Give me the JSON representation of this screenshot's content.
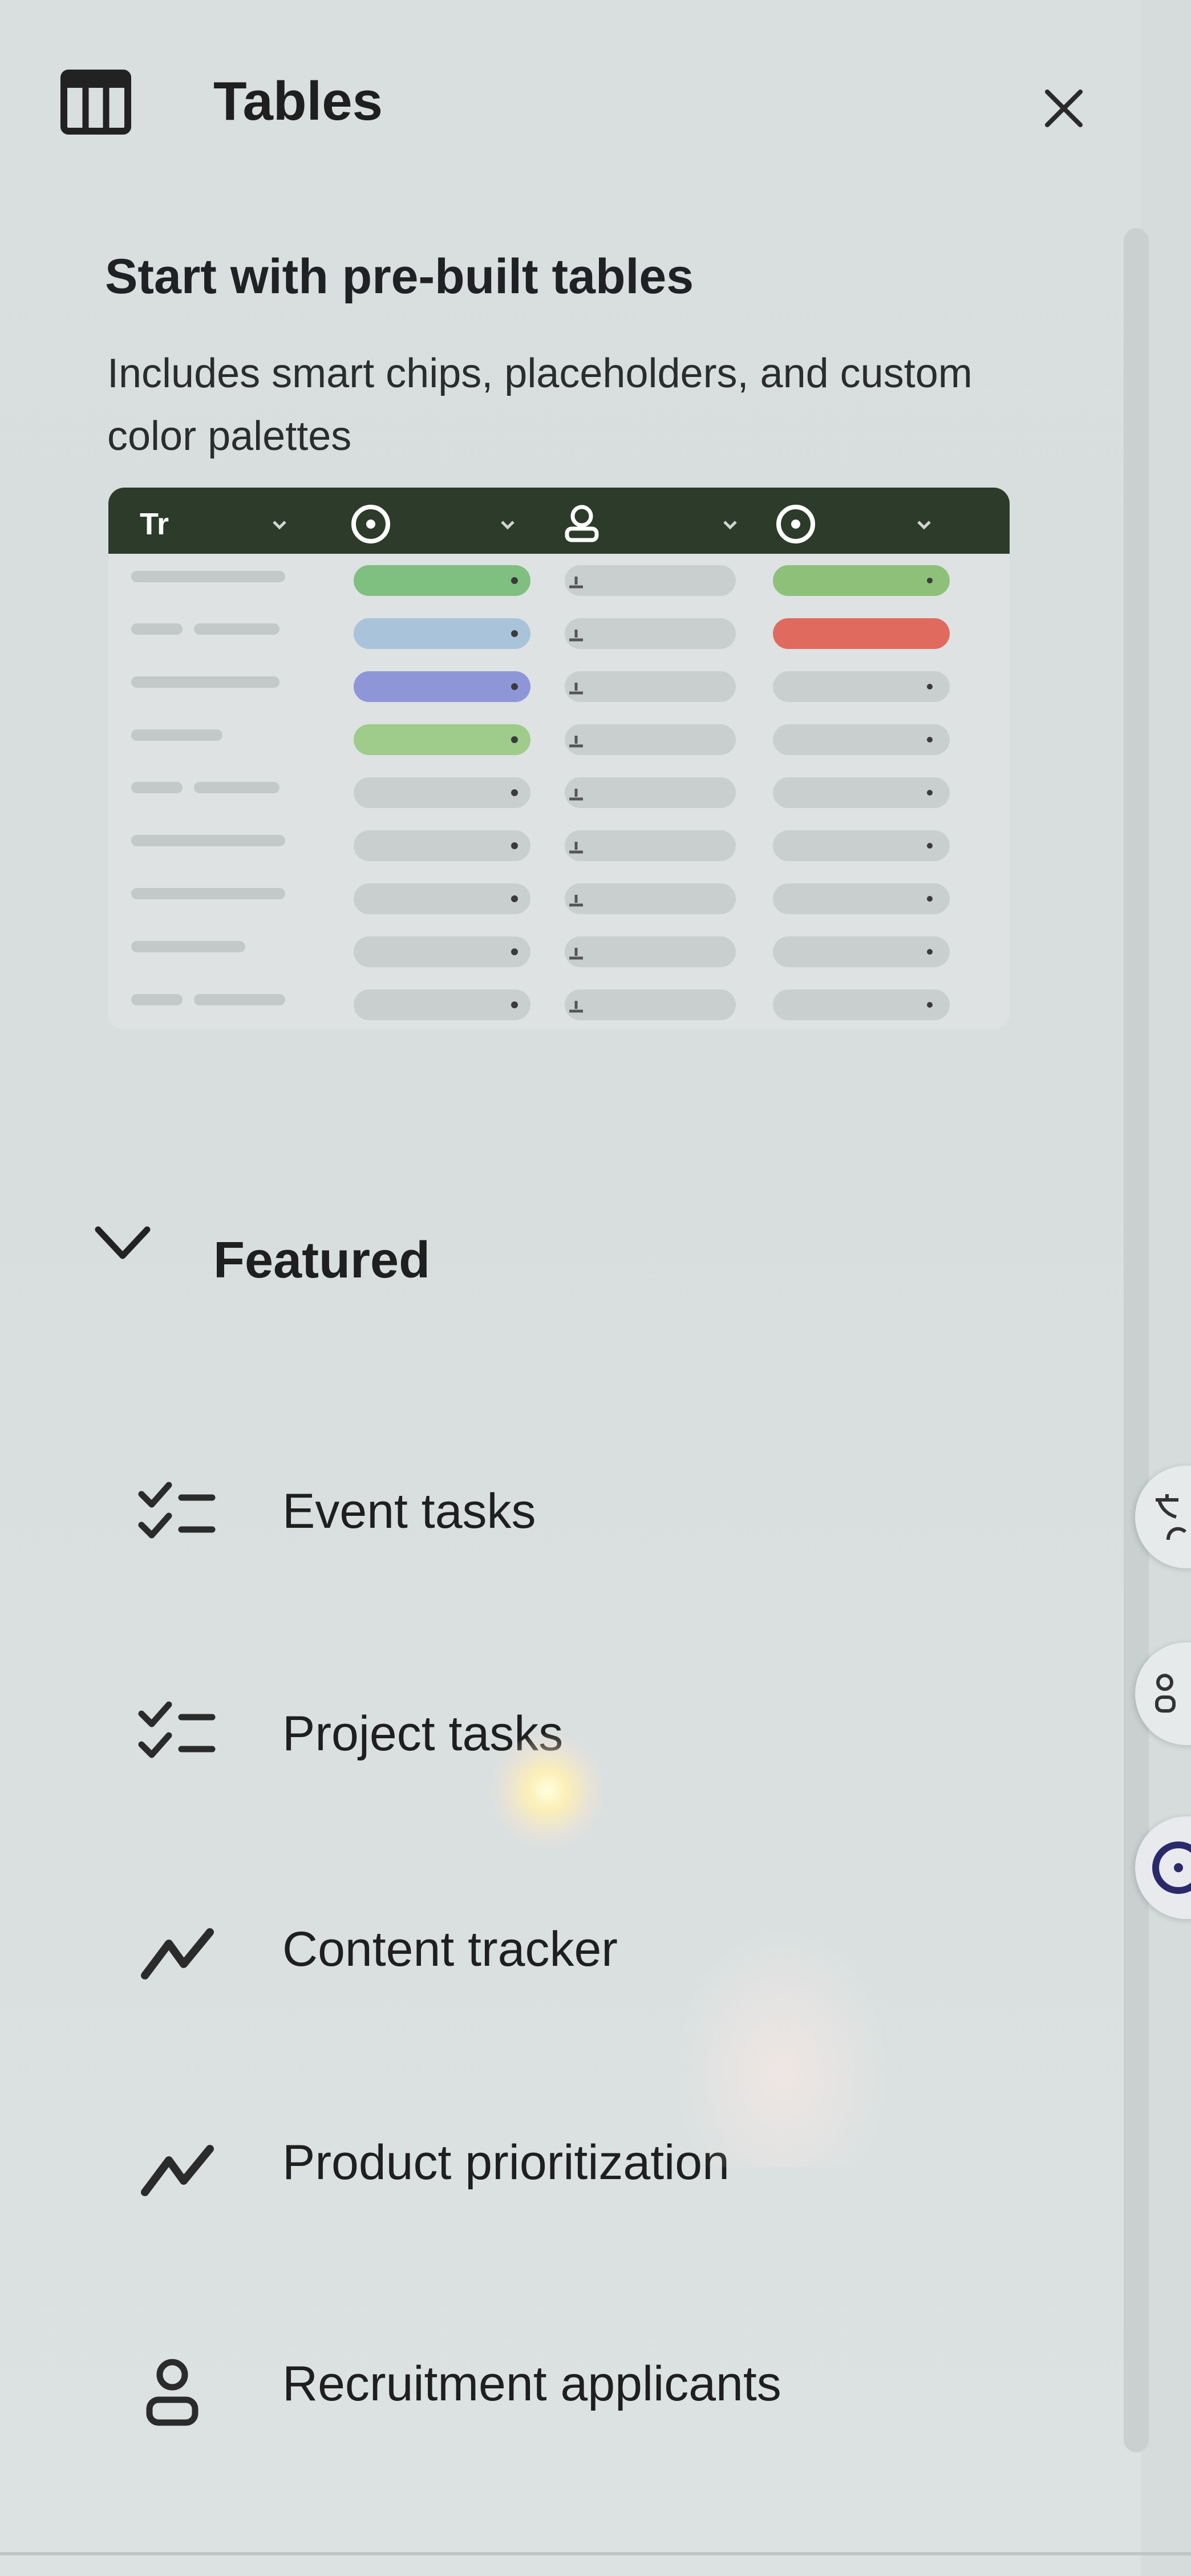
{
  "header": {
    "title": "Tables",
    "icon": "table-icon",
    "close_icon": "close-icon"
  },
  "intro": {
    "heading": "Start with pre-built tables",
    "description": "Includes smart chips, placeholders, and custom color palettes"
  },
  "preview": {
    "header_bg": "#2c3b2a",
    "columns": [
      {
        "icon": "text-type-icon",
        "glyph": "Tr"
      },
      {
        "icon": "dropdown-chip-icon"
      },
      {
        "icon": "person-icon"
      },
      {
        "icon": "dropdown-chip-icon"
      }
    ],
    "chip_colors": {
      "green": "#7fbf7f",
      "blue": "#a9c3db",
      "purple": "#8f96d8",
      "lightgreen": "#9fcb8b",
      "red": "#e06a5e",
      "grey": "#c9cfcf"
    }
  },
  "featured": {
    "label": "Featured",
    "toggle_icon": "chevron-down-icon",
    "items": [
      {
        "label": "Event tasks",
        "icon": "checklist-icon"
      },
      {
        "label": "Project tasks",
        "icon": "checklist-icon"
      },
      {
        "label": "Content tracker",
        "icon": "trend-line-icon"
      },
      {
        "label": "Product prioritization",
        "icon": "trend-line-icon"
      },
      {
        "label": "Recruitment applicants",
        "icon": "person-icon"
      }
    ]
  }
}
